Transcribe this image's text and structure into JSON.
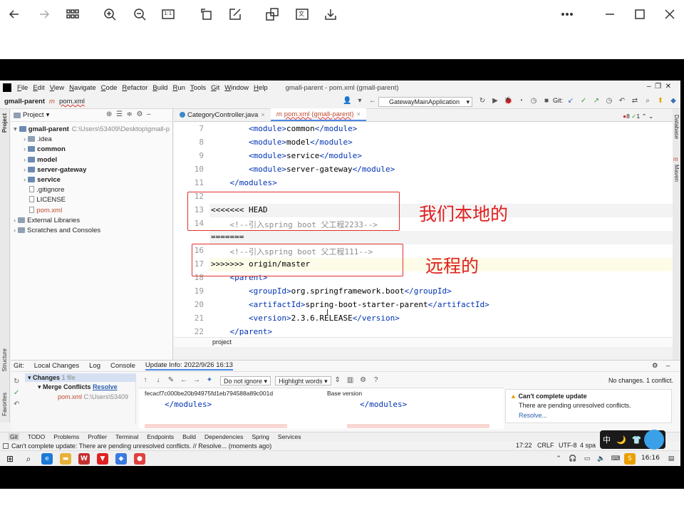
{
  "viewer": {
    "buttons": [
      "back",
      "forward",
      "grid",
      "zoom-in",
      "zoom-out",
      "actual-size",
      "rotate",
      "edit",
      "translate-image",
      "translate-text",
      "download",
      "more",
      "minimize",
      "maximize",
      "close"
    ],
    "icon_labels": {
      "actual": "1:1",
      "translate": "文"
    }
  },
  "ide": {
    "menu": [
      "File",
      "Edit",
      "View",
      "Navigate",
      "Code",
      "Refactor",
      "Build",
      "Run",
      "Tools",
      "Git",
      "Window",
      "Help"
    ],
    "window_title": "gmall-parent - pom.xml (gmall-parent)",
    "breadcrumb": [
      "gmall-parent",
      "pom.xml"
    ],
    "breadcrumb_icon": "m",
    "run_config": "GatewayMainApplication",
    "git_label": "Git:",
    "project_panel": {
      "title": "Project",
      "rows": [
        {
          "label": "gmall-parent",
          "extra": "C:\\Users\\53409\\Desktop\\gmall-p",
          "level": 0,
          "bold": true,
          "expanded": true
        },
        {
          "label": ".idea",
          "extra": "",
          "level": 1,
          "bold": false
        },
        {
          "label": "common",
          "extra": "",
          "level": 1,
          "bold": true
        },
        {
          "label": "model",
          "extra": "",
          "level": 1,
          "bold": true
        },
        {
          "label": "server-gateway",
          "extra": "",
          "level": 1,
          "bold": true
        },
        {
          "label": "service",
          "extra": "",
          "level": 1,
          "bold": true
        },
        {
          "label": ".gitignore",
          "extra": "",
          "level": 1,
          "bold": false
        },
        {
          "label": "LICENSE",
          "extra": "",
          "level": 1,
          "bold": false
        },
        {
          "label": "pom.xml",
          "extra": "",
          "level": 1,
          "bold": false,
          "red": true
        },
        {
          "label": "External Libraries",
          "extra": "",
          "level": 0,
          "bold": false
        },
        {
          "label": "Scratches and Consoles",
          "extra": "",
          "level": 0,
          "bold": false
        }
      ]
    },
    "editor_tabs": [
      {
        "label": "CategoryController.java",
        "active": false
      },
      {
        "label": "pom.xml (gmall-parent)",
        "active": true
      }
    ],
    "inspection": {
      "warnings": "8",
      "ok": "1"
    },
    "code_lines": [
      {
        "n": "7",
        "indent": "        ",
        "parts": [
          {
            "t": "<module>",
            "c": "tag"
          },
          {
            "t": "common",
            "c": ""
          },
          {
            "t": "</module>",
            "c": "tag"
          }
        ]
      },
      {
        "n": "8",
        "indent": "        ",
        "parts": [
          {
            "t": "<module>",
            "c": "tag"
          },
          {
            "t": "model",
            "c": ""
          },
          {
            "t": "</module>",
            "c": "tag"
          }
        ]
      },
      {
        "n": "9",
        "indent": "        ",
        "parts": [
          {
            "t": "<module>",
            "c": "tag"
          },
          {
            "t": "service",
            "c": ""
          },
          {
            "t": "</module>",
            "c": "tag"
          }
        ]
      },
      {
        "n": "10",
        "indent": "        ",
        "parts": [
          {
            "t": "<module>",
            "c": "tag"
          },
          {
            "t": "server-gateway",
            "c": ""
          },
          {
            "t": "</module>",
            "c": "tag"
          }
        ]
      },
      {
        "n": "11",
        "indent": "    ",
        "parts": [
          {
            "t": "</modules>",
            "c": "tag"
          }
        ]
      },
      {
        "n": "12",
        "indent": "",
        "parts": []
      },
      {
        "n": "13",
        "indent": "",
        "parts": [
          {
            "t": "<<<<<<< HEAD",
            "c": ""
          }
        ],
        "conflict": true
      },
      {
        "n": "14",
        "indent": "    ",
        "parts": [
          {
            "t": "<!--引入spring boot 父工程2233-->",
            "c": "cmt"
          }
        ]
      },
      {
        "n": "",
        "indent": "",
        "parts": [
          {
            "t": "=======",
            "c": ""
          }
        ],
        "conflict": true
      },
      {
        "n": "16",
        "indent": "    ",
        "parts": [
          {
            "t": "<!--引入spring boot 父工程111-->",
            "c": "cmt"
          }
        ]
      },
      {
        "n": "17",
        "indent": "",
        "parts": [
          {
            "t": ">>>>>>> origin/master",
            "c": ""
          }
        ],
        "highlight": true
      },
      {
        "n": "18",
        "indent": "    ",
        "parts": [
          {
            "t": "<parent>",
            "c": "tag"
          }
        ]
      },
      {
        "n": "19",
        "indent": "        ",
        "parts": [
          {
            "t": "<groupId>",
            "c": "tag"
          },
          {
            "t": "org.springframework.boot",
            "c": ""
          },
          {
            "t": "</groupId>",
            "c": "tag"
          }
        ]
      },
      {
        "n": "20",
        "indent": "        ",
        "parts": [
          {
            "t": "<artifactId>",
            "c": "tag"
          },
          {
            "t": "spring-boot-starter-parent",
            "c": ""
          },
          {
            "t": "</artifactId>",
            "c": "tag"
          }
        ]
      },
      {
        "n": "21",
        "indent": "        ",
        "parts": [
          {
            "t": "<version>",
            "c": "tag"
          },
          {
            "t": "2.3.6.RELEASE",
            "c": ""
          },
          {
            "t": "</version>",
            "c": "tag"
          }
        ]
      },
      {
        "n": "22",
        "indent": "    ",
        "parts": [
          {
            "t": "</parent>",
            "c": "tag"
          }
        ]
      }
    ],
    "editor_breadcrumb": "project",
    "annotations": {
      "local": "我们本地的",
      "remote": "远程的"
    },
    "git_panel": {
      "tabs": [
        "Git:",
        "Local Changes",
        "Log",
        "Console",
        "Update Info: 2022/9/26 16:13"
      ],
      "tree_root": "Changes",
      "tree_root_count": "1 file",
      "merge_conflicts": "Merge Conflicts",
      "resolve": "Resolve",
      "conflict_file": "pom.xml",
      "conflict_file_path": "C:\\Users\\53409",
      "filter": "Do not ignore",
      "highlight": "Highlight words",
      "status": "No changes. 1 conflict.",
      "left_hash": "fecacf7c000be20b94975fd1eb794588a89c001d",
      "base_version": "Base version",
      "left_code": "</modules>",
      "right_code": "</modules>",
      "warning_title": "Can't complete update",
      "warning_body": "There are pending unresolved conflicts.",
      "warning_link": "Resolve..."
    },
    "tool_tabs": [
      "Git",
      "TODO",
      "Problems",
      "Profiler",
      "Terminal",
      "Endpoints",
      "Build",
      "Dependencies",
      "Spring",
      "Services"
    ],
    "status_message": "Can't complete update: There are pending unresolved conflicts. // Resolve... (moments ago)",
    "status_right": [
      "17:22",
      "CRLF",
      "UTF-8",
      "4 spa"
    ],
    "ime": [
      "中",
      "🌙",
      "👕"
    ],
    "side_labels": {
      "project": "Project",
      "structure": "Structure",
      "favorites": "Favorites",
      "database": "Database",
      "maven": "Maven",
      "maven_icon": "m"
    }
  },
  "taskbar": {
    "time": "16:16",
    "wps_label": "W"
  }
}
